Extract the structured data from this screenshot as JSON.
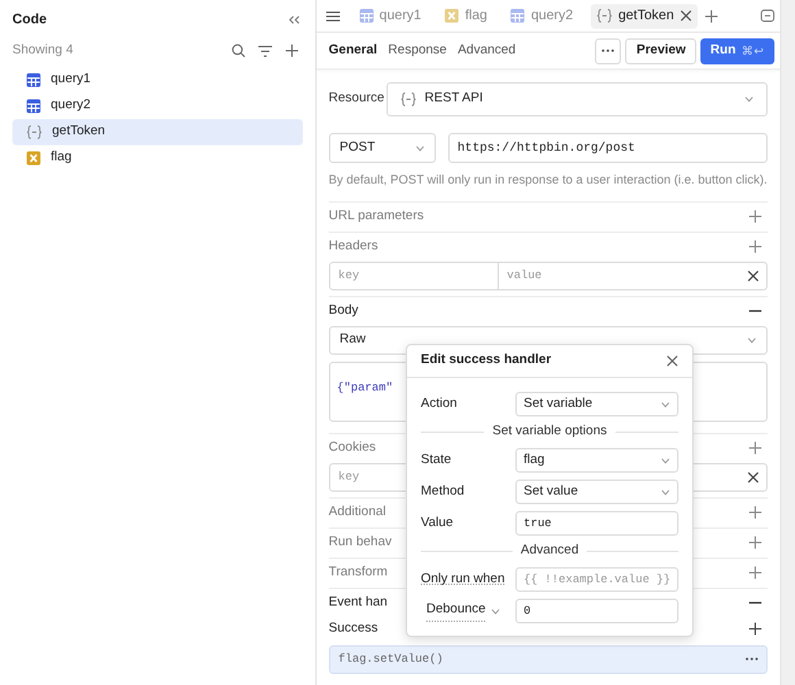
{
  "sidebar": {
    "title": "Code",
    "count_label": "Showing 4",
    "items": [
      {
        "label": "query1",
        "kind": "table",
        "selected": false
      },
      {
        "label": "query2",
        "kind": "table",
        "selected": false
      },
      {
        "label": "getToken",
        "kind": "rest",
        "selected": true
      },
      {
        "label": "flag",
        "kind": "variable",
        "selected": false
      }
    ]
  },
  "tabs": [
    {
      "label": "query1",
      "kind": "table",
      "selected": false
    },
    {
      "label": "flag",
      "kind": "variable",
      "selected": false
    },
    {
      "label": "query2",
      "kind": "table",
      "selected": false
    },
    {
      "label": "getToken",
      "kind": "rest",
      "selected": true
    }
  ],
  "subtabs": [
    {
      "label": "General",
      "selected": true
    },
    {
      "label": "Response",
      "selected": false
    },
    {
      "label": "Advanced",
      "selected": false
    }
  ],
  "preview_button": "Preview",
  "run_button": {
    "label": "Run",
    "shortcut": "⌘↩"
  },
  "resource": {
    "label": "Resource",
    "value": "REST API"
  },
  "method": "POST",
  "url": "https://httpbin.org/post",
  "hint": "By default, POST will only run in response to a user interaction (i.e. button click).",
  "sections": [
    {
      "kind": "section",
      "label": "URL parameters",
      "expanded": false
    },
    {
      "kind": "section",
      "label": "Headers",
      "expanded": false
    },
    {
      "kind": "kv",
      "key_placeholder": "key",
      "value_placeholder": "value"
    },
    {
      "kind": "section",
      "label": "Body",
      "expanded": true
    },
    {
      "kind": "select",
      "value": "Raw"
    },
    {
      "kind": "code",
      "text": "{\"param\""
    },
    {
      "kind": "section",
      "label": "Cookies",
      "expanded": false
    },
    {
      "kind": "kv",
      "key_placeholder": "key"
    },
    {
      "kind": "section",
      "label": "Additional",
      "expanded": false
    },
    {
      "kind": "section",
      "label": "Run behav",
      "expanded": false
    },
    {
      "kind": "section",
      "label": "Transform",
      "expanded": false
    },
    {
      "kind": "section",
      "label": "Event han",
      "expanded": true
    },
    {
      "kind": "subsection",
      "label": "Success"
    },
    {
      "kind": "handler",
      "text": "flag.setValue()"
    }
  ],
  "modal": {
    "title": "Edit success handler",
    "rows": [
      {
        "kind": "select",
        "label": "Action",
        "value": "Set variable"
      },
      {
        "kind": "heading",
        "label": "Set variable options"
      },
      {
        "kind": "select",
        "label": "State",
        "value": "flag"
      },
      {
        "kind": "select",
        "label": "Method",
        "value": "Set value"
      },
      {
        "kind": "input",
        "label": "Value",
        "value": "true"
      },
      {
        "kind": "heading",
        "label": "Advanced"
      },
      {
        "kind": "input",
        "label": "Only run when",
        "placeholder": "{{ !!example.value }}"
      },
      {
        "kind": "menu-input",
        "label": "Debounce",
        "value": "0"
      }
    ]
  }
}
